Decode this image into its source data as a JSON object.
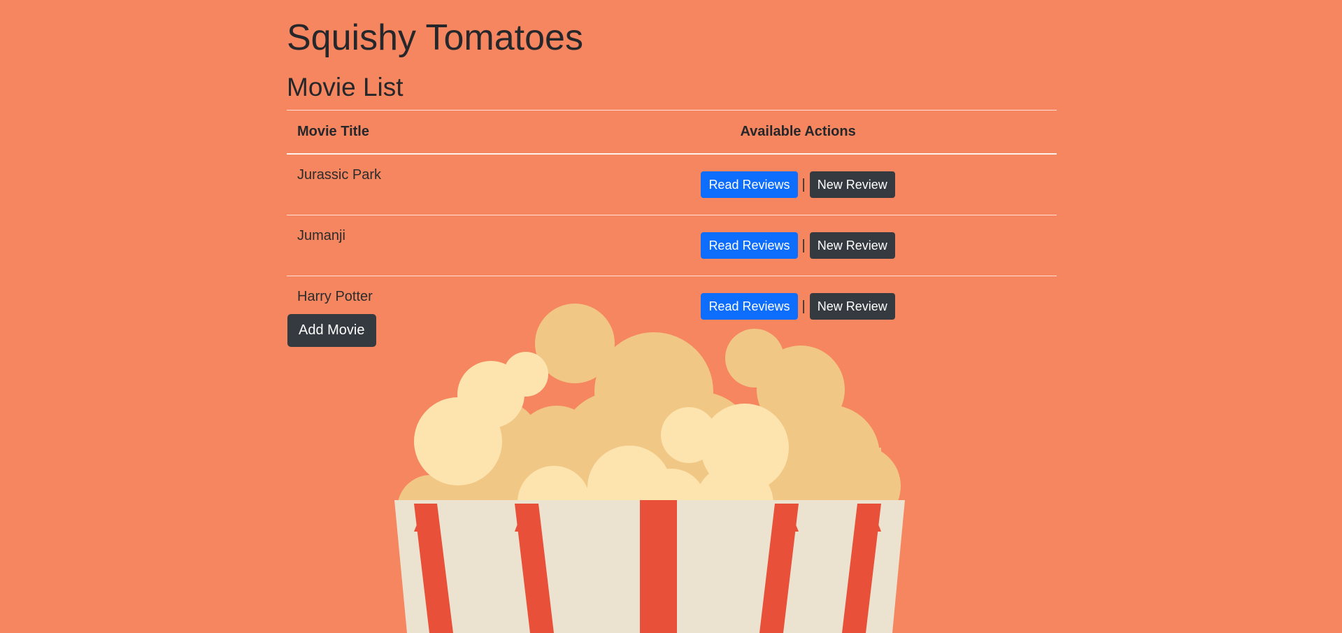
{
  "site": {
    "title": "Squishy Tomatoes"
  },
  "list": {
    "heading": "Movie List",
    "columns": [
      "Movie Title",
      "Available Actions"
    ],
    "rows": [
      {
        "title": "Jurassic Park",
        "read_label": "Read Reviews",
        "separator": "|",
        "new_label": "New Review"
      },
      {
        "title": "Jumanji",
        "read_label": "Read Reviews",
        "separator": "|",
        "new_label": "New Review"
      },
      {
        "title": "Harry Potter",
        "read_label": "Read Reviews",
        "separator": "|",
        "new_label": "New Review"
      }
    ]
  },
  "actions": {
    "add_movie_label": "Add Movie"
  },
  "colors": {
    "background": "#f5865f",
    "primary_button": "#0d6efd",
    "dark_button": "#343a40",
    "popcorn_dark": "#f1c785",
    "popcorn_light": "#fde3ad",
    "bucket_cream": "#ebe2d0",
    "bucket_red": "#e8503a"
  },
  "illustration": {
    "icon": "popcorn-bucket-icon"
  }
}
